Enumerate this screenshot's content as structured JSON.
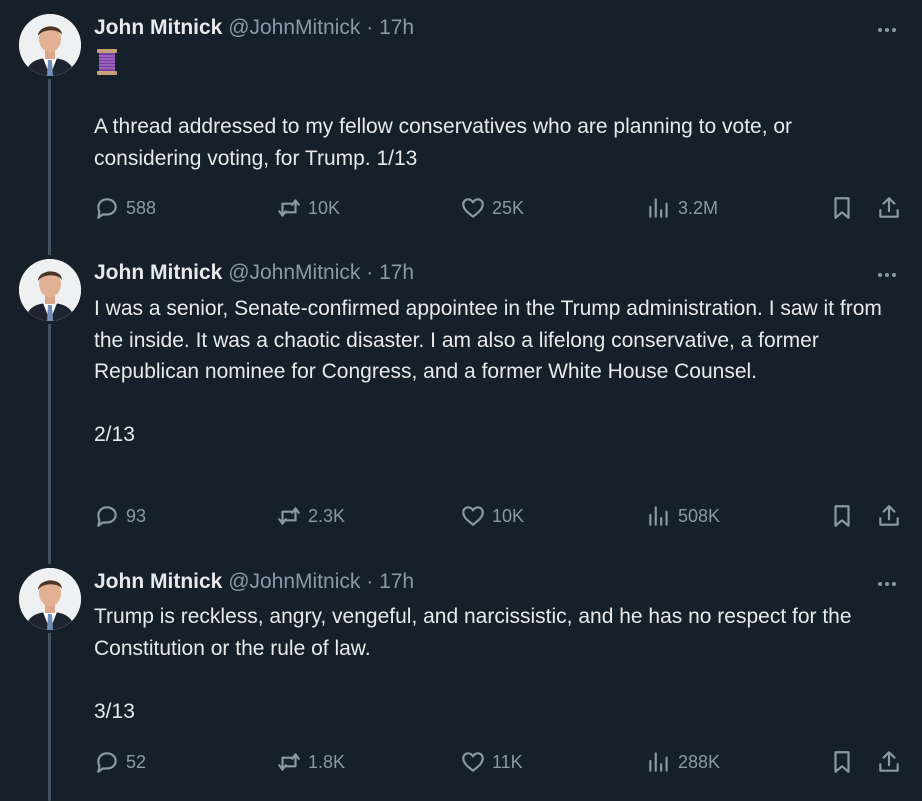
{
  "tweets": [
    {
      "author": {
        "name": "John Mitnick",
        "handle": "@JohnMitnick",
        "time": "17h"
      },
      "emoji": "spool-of-thread-icon",
      "text": "A thread addressed to my fellow conservatives who are planning to vote, or considering voting, for Trump. 1/13",
      "stats": {
        "replies": "588",
        "reposts": "10K",
        "likes": "25K",
        "views": "3.2M"
      }
    },
    {
      "author": {
        "name": "John Mitnick",
        "handle": "@JohnMitnick",
        "time": "17h"
      },
      "text": "I was a senior, Senate-confirmed appointee in the Trump administration. I saw it from the inside. It was a chaotic disaster. I am also a lifelong conservative, a former Republican nominee for Congress, and a former White House Counsel.\n\n2/13",
      "stats": {
        "replies": "93",
        "reposts": "2.3K",
        "likes": "10K",
        "views": "508K"
      }
    },
    {
      "author": {
        "name": "John Mitnick",
        "handle": "@JohnMitnick",
        "time": "17h"
      },
      "text": "Trump is reckless, angry, vengeful, and narcissistic, and he has no respect for the Constitution or the rule of law.\n\n3/13",
      "stats": {
        "replies": "52",
        "reposts": "1.8K",
        "likes": "11K",
        "views": "288K"
      }
    }
  ],
  "separator": "·",
  "colors": {
    "background": "#15202b",
    "text": "#e7e9ea",
    "muted": "#8b98a5",
    "thread_line": "#425364"
  }
}
